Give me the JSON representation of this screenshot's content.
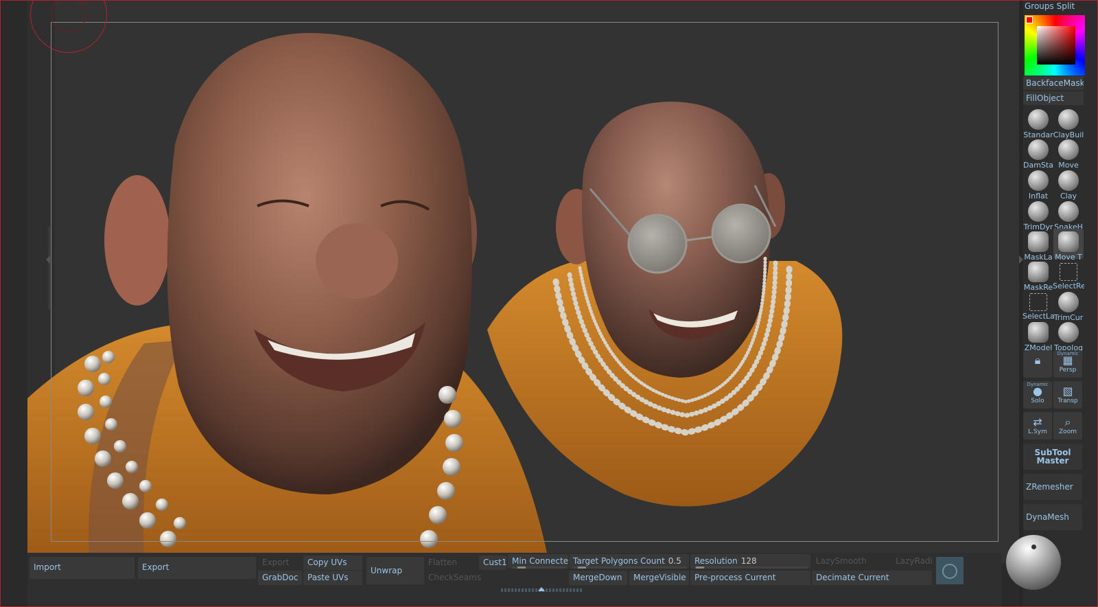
{
  "right_tray": {
    "groups_split": "Groups Split",
    "backface_mask": "BackfaceMask",
    "fill_object": "FillObject",
    "brushes": [
      {
        "label": "Standar",
        "icon": "standard-brush-icon"
      },
      {
        "label": "ClayBuil",
        "icon": "claybuildup-brush-icon"
      },
      {
        "label": "DamSta",
        "icon": "damstandard-brush-icon"
      },
      {
        "label": "Move",
        "icon": "move-brush-icon"
      },
      {
        "label": "Inflat",
        "icon": "inflate-brush-icon"
      },
      {
        "label": "Clay",
        "icon": "clay-brush-icon"
      },
      {
        "label": "TrimDyr",
        "icon": "trimdynamic-brush-icon"
      },
      {
        "label": "SnakeH",
        "icon": "snakehook-brush-icon"
      },
      {
        "label": "MaskLa",
        "icon": "masklasso-brush-icon"
      },
      {
        "label": "Move T",
        "icon": "move-topological-brush-icon"
      },
      {
        "label": "MaskRe",
        "icon": "maskrect-brush-icon"
      },
      {
        "label": "SelectRe",
        "icon": "selectrect-brush-icon"
      },
      {
        "label": "SelectLa",
        "icon": "selectlasso-brush-icon"
      },
      {
        "label": "TrimCur",
        "icon": "trimcurve-brush-icon"
      },
      {
        "label": "ZModel",
        "icon": "zmodeler-brush-icon"
      },
      {
        "label": "Topolog",
        "icon": "topology-brush-icon"
      }
    ],
    "tools": {
      "lock_label": "",
      "persp_tag": "Dynamic",
      "persp_label": "Persp",
      "solo_tag": "Dynamic",
      "solo_label": "Solo",
      "transp_label": "Transp",
      "lsym_label": "L.Sym",
      "zoom_label": "Zoom"
    },
    "subtool_master_line1": "SubTool",
    "subtool_master_line2": "Master",
    "zremesher": "ZRemesher",
    "dynamesh": "DynaMesh"
  },
  "bottom_panel": {
    "import": "Import",
    "export_main": "Export",
    "export_dim": "Export",
    "copy_uvs": "Copy UVs",
    "grabdoc": "GrabDoc",
    "paste_uvs": "Paste UVs",
    "unwrap": "Unwrap",
    "flatten": "Flatten",
    "checkseams": "CheckSeams",
    "cust1": "Cust1",
    "min_connected": "Min Connected P",
    "target_polygons_label": "Target Polygons Count",
    "target_polygons_value": "0.5",
    "resolution_label": "Resolution",
    "resolution_value": "128",
    "lazysmooth": "LazySmooth",
    "lazyradius": "LazyRadius",
    "mergedown": "MergeDown",
    "mergevisible": "MergeVisible",
    "preprocess_current": "Pre-process Current",
    "decimate_current": "Decimate Current"
  },
  "colors": {
    "accent_text": "#9cc5e8",
    "skin": "#8a5a48",
    "robe": "#c6781f",
    "pearl": "#d8d4cc",
    "brush_ring": "#b3242a"
  }
}
